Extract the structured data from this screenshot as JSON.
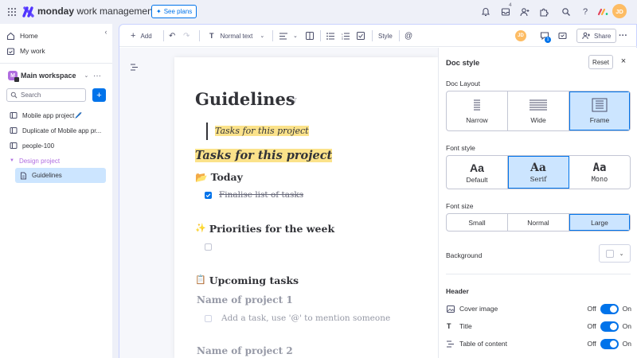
{
  "topbar": {
    "brand_bold": "monday",
    "brand_light": "work management",
    "see_plans": "See plans",
    "inbox_badge": "4",
    "avatar_initials": "JD",
    "colors": {
      "brand": "#5034ff",
      "avatar": "#fdbc64"
    }
  },
  "sidebar": {
    "home": "Home",
    "my_work": "My work",
    "workspace_initial": "M",
    "workspace_name": "Main workspace",
    "search_placeholder": "Search",
    "items": [
      {
        "label": "Mobile app project🖊️",
        "icon": "board-icon"
      },
      {
        "label": "Duplicate of Mobile app pr...",
        "icon": "board-icon"
      },
      {
        "label": "people-100",
        "icon": "board-icon"
      },
      {
        "label": "Design project",
        "icon": "folder-caret-icon"
      },
      {
        "label": "Guidelines",
        "icon": "doc-icon"
      }
    ]
  },
  "toolbar": {
    "add": "Add",
    "text_style": "Normal text",
    "style": "Style",
    "share": "Share",
    "avatar_initials": "JD",
    "comments_badge": "1"
  },
  "doc": {
    "title": "Guidelines",
    "quote": "Tasks for this project",
    "highlight_heading": "Tasks for this project",
    "today_emoji": "📂",
    "today": "Today",
    "done_task": "Finalise list of tasks",
    "priorities_emoji": "✨",
    "priorities": "Priorities for the week",
    "upcoming_emoji": "📋",
    "upcoming": "Upcoming tasks",
    "project1": "Name of project 1",
    "add_task_placeholder": "Add a task, use '@' to mention someone",
    "project2": "Name of project 2"
  },
  "panel": {
    "title": "Doc style",
    "reset": "Reset",
    "layout_label": "Doc Layout",
    "layouts": [
      "Narrow",
      "Wide",
      "Frame"
    ],
    "layout_selected": "Frame",
    "font_style_label": "Font style",
    "font_preview": "Aa",
    "fonts": [
      "Default",
      "Serif",
      "Mono"
    ],
    "font_selected": "Serif",
    "font_size_label": "Font size",
    "sizes": [
      "Small",
      "Normal",
      "Large"
    ],
    "size_selected": "Large",
    "background_label": "Background",
    "header_label": "Header",
    "header_rows": [
      {
        "label": "Cover image",
        "off": "Off",
        "on": "On",
        "state": "on"
      },
      {
        "label": "Title",
        "off": "Off",
        "on": "On",
        "state": "on"
      },
      {
        "label": "Table of content",
        "off": "Off",
        "on": "On",
        "state": "on"
      }
    ],
    "colors": {
      "accent": "#0073ea",
      "selected_bg": "#cce5ff"
    }
  }
}
